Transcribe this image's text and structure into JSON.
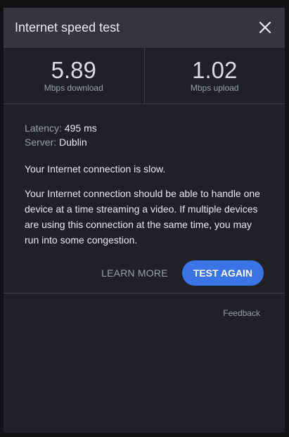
{
  "header": {
    "title": "Internet speed test",
    "close_icon": "close-icon"
  },
  "results": {
    "download_value": "5.89",
    "download_label": "Mbps download",
    "upload_value": "1.02",
    "upload_label": "Mbps upload"
  },
  "details": {
    "latency_key": "Latency:",
    "latency_value": "495 ms",
    "server_key": "Server:",
    "server_value": "Dublin"
  },
  "message": {
    "headline": "Your Internet connection is slow.",
    "description": "Your Internet connection should be able to handle one device at a time streaming a video. If multiple devices are using this connection at the same time, you may run into some congestion."
  },
  "actions": {
    "learn_more": "LEARN MORE",
    "test_again": "TEST AGAIN"
  },
  "footer": {
    "feedback": "Feedback"
  },
  "colors": {
    "accent": "#3b75e5",
    "panel_bg": "#202124",
    "header_bg": "#35363a"
  }
}
